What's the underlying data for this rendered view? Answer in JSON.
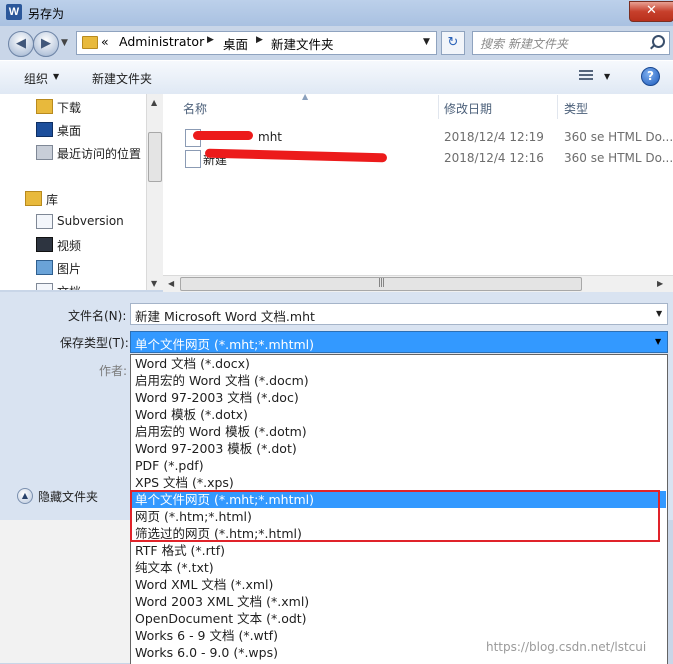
{
  "window": {
    "title": "另存为",
    "app_icon": "W",
    "close": "✕"
  },
  "nav": {
    "back": "◀",
    "forward": "▶",
    "dropdown": "▼",
    "breadcrumb": [
      "Administrator",
      "桌面",
      "新建文件夹"
    ],
    "breadcrumb_prefix": "«",
    "refresh": "↻",
    "search_placeholder": "搜索 新建文件夹"
  },
  "toolbar": {
    "organize": "组织",
    "new_folder": "新建文件夹",
    "help": "?"
  },
  "sidebar": {
    "items": [
      {
        "label": "下载",
        "icon": "download-folder-icon"
      },
      {
        "label": "桌面",
        "icon": "desktop-icon"
      },
      {
        "label": "最近访问的位置",
        "icon": "recent-places-icon"
      },
      {
        "label": "库",
        "icon": "library-icon"
      },
      {
        "label": "Subversion",
        "icon": "document-library-icon"
      },
      {
        "label": "视频",
        "icon": "video-library-icon"
      },
      {
        "label": "图片",
        "icon": "picture-library-icon"
      },
      {
        "label": "文档",
        "icon": "document-library-icon"
      }
    ]
  },
  "file_list": {
    "columns": [
      "名称",
      "修改日期",
      "类型"
    ],
    "rows": [
      {
        "name": "mht",
        "date": "2018/12/4 12:19",
        "type": "360 se HTML Do..."
      },
      {
        "name": "新建",
        "date": "2018/12/4 12:16",
        "type": "360 se HTML Do..."
      }
    ]
  },
  "form": {
    "filename_label": "文件名(N):",
    "filename_value": "新建 Microsoft Word 文档.mht",
    "savetype_label": "保存类型(T):",
    "savetype_value": "单个文件网页 (*.mht;*.mhtml)",
    "author_label": "作者:",
    "hide_folders": "隐藏文件夹"
  },
  "save_types": [
    "Word 文档 (*.docx)",
    "启用宏的 Word 文档 (*.docm)",
    "Word 97-2003 文档 (*.doc)",
    "Word 模板 (*.dotx)",
    "启用宏的 Word 模板 (*.dotm)",
    "Word 97-2003 模板 (*.dot)",
    "PDF (*.pdf)",
    "XPS 文档 (*.xps)",
    "单个文件网页 (*.mht;*.mhtml)",
    "网页 (*.htm;*.html)",
    "筛选过的网页 (*.htm;*.html)",
    "RTF 格式 (*.rtf)",
    "纯文本 (*.txt)",
    "Word XML 文档 (*.xml)",
    "Word 2003 XML 文档 (*.xml)",
    "OpenDocument 文本 (*.odt)",
    "Works 6 - 9 文档 (*.wtf)",
    "Works 6.0 - 9.0 (*.wps)"
  ],
  "selected_save_type_index": 8,
  "watermark": "https://blog.csdn.net/lstcui",
  "colors": {
    "selection": "#3399ff",
    "highlight_box": "#e0232a",
    "redaction": "#ec1b1b"
  }
}
